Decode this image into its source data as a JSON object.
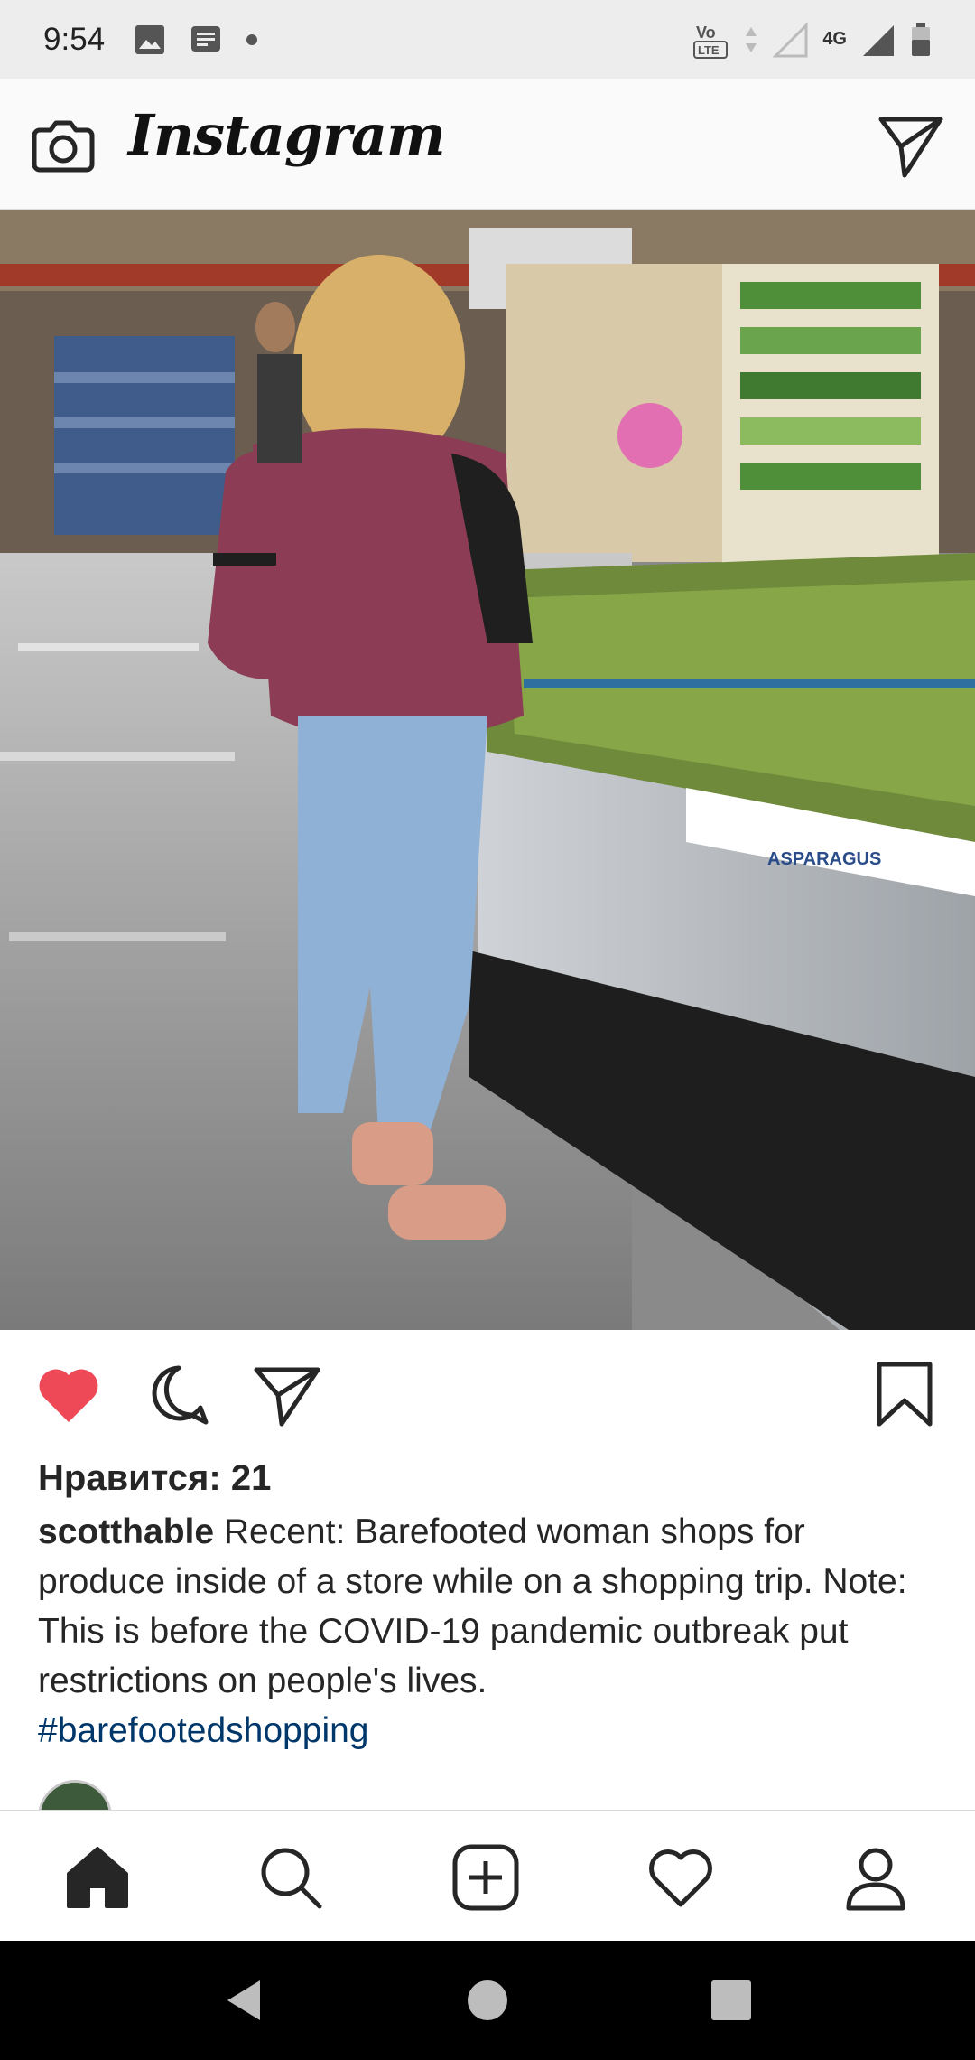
{
  "status_bar": {
    "time": "9:54",
    "network_label": "4G",
    "volte_label": "LTE"
  },
  "header": {
    "brand": "Instagram",
    "icons": [
      "camera-icon",
      "direct-message-icon"
    ]
  },
  "post": {
    "likes": "Нравится: 21",
    "username": "scotthable",
    "caption": "Recent: Barefooted woman shops for produce inside of a store while on a shopping trip. Note: This is before the COVID-19 pandemic outbreak put restrictions on people's lives.",
    "hashtag": "#barefootedshopping",
    "liked": true,
    "like_color": "#ed4956",
    "hashtag_color": "#00376b",
    "image_sign_text": "ASPARAGUS"
  },
  "bottom_nav": {
    "items": [
      "home-icon",
      "search-icon",
      "new-post-icon",
      "activity-icon",
      "profile-icon"
    ],
    "active": "home-icon"
  },
  "system_nav": {
    "items": [
      "back-icon",
      "home-circle-icon",
      "recents-icon"
    ]
  }
}
